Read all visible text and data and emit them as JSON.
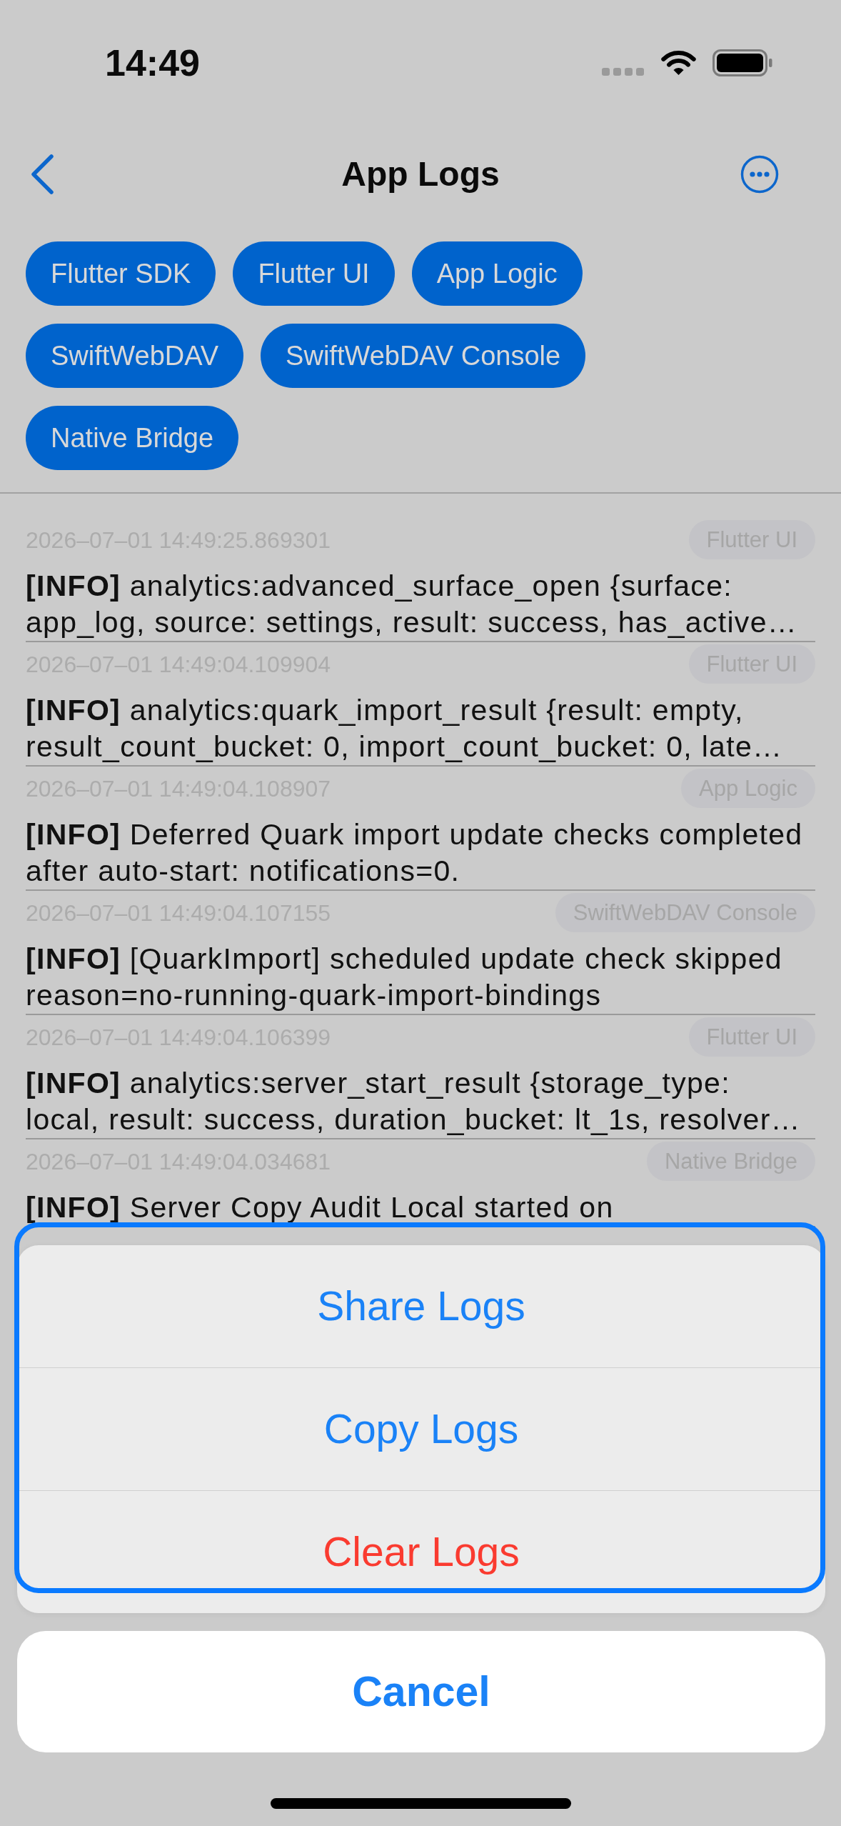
{
  "status_bar": {
    "time": "14:49"
  },
  "nav": {
    "title": "App Logs"
  },
  "filters": [
    {
      "label": "Flutter SDK",
      "selected": true
    },
    {
      "label": "Flutter UI",
      "selected": true
    },
    {
      "label": "App Logic",
      "selected": true
    },
    {
      "label": "SwiftWebDAV",
      "selected": true
    },
    {
      "label": "SwiftWebDAV Console",
      "selected": true
    },
    {
      "label": "Native Bridge",
      "selected": true
    }
  ],
  "logs": [
    {
      "timestamp": "2026–07–01 14:49:25.869301",
      "source": "Flutter UI",
      "lines": [
        "**[INFO]** analytics:advanced_surface_open {surface:",
        "app_log, source: settings, result: success, has_active…"
      ]
    },
    {
      "timestamp": "2026–07–01 14:49:04.109904",
      "source": "Flutter UI",
      "lines": [
        "**[INFO]** analytics:quark_import_result {result: empty,",
        "result_count_bucket: 0, import_count_bucket: 0, late…"
      ]
    },
    {
      "timestamp": "2026–07–01 14:49:04.108907",
      "source": "App Logic",
      "lines": [
        "**[INFO]** Deferred Quark import update checks completed",
        "after auto-start: notifications=0."
      ]
    },
    {
      "timestamp": "2026–07–01 14:49:04.107155",
      "source": "SwiftWebDAV Console",
      "lines": [
        "**[INFO]** [QuarkImport] scheduled update check skipped",
        "reason=no-running-quark-import-bindings"
      ]
    },
    {
      "timestamp": "2026–07–01 14:49:04.106399",
      "source": "Flutter UI",
      "lines": [
        "**[INFO]** analytics:server_start_result {storage_type:",
        "local, result: success, duration_bucket: lt_1s, resolver…"
      ]
    },
    {
      "timestamp": "2026–07–01 14:49:04.034681",
      "source": "Native Bridge",
      "lines": [
        "**[INFO]** Server Copy Audit Local started on"
      ]
    }
  ],
  "action_sheet": {
    "highlighted": true,
    "actions": [
      {
        "label": "Share Logs",
        "destructive": false
      },
      {
        "label": "Copy Logs",
        "destructive": false
      },
      {
        "label": "Clear Logs",
        "destructive": true
      }
    ],
    "cancel": "Cancel"
  }
}
